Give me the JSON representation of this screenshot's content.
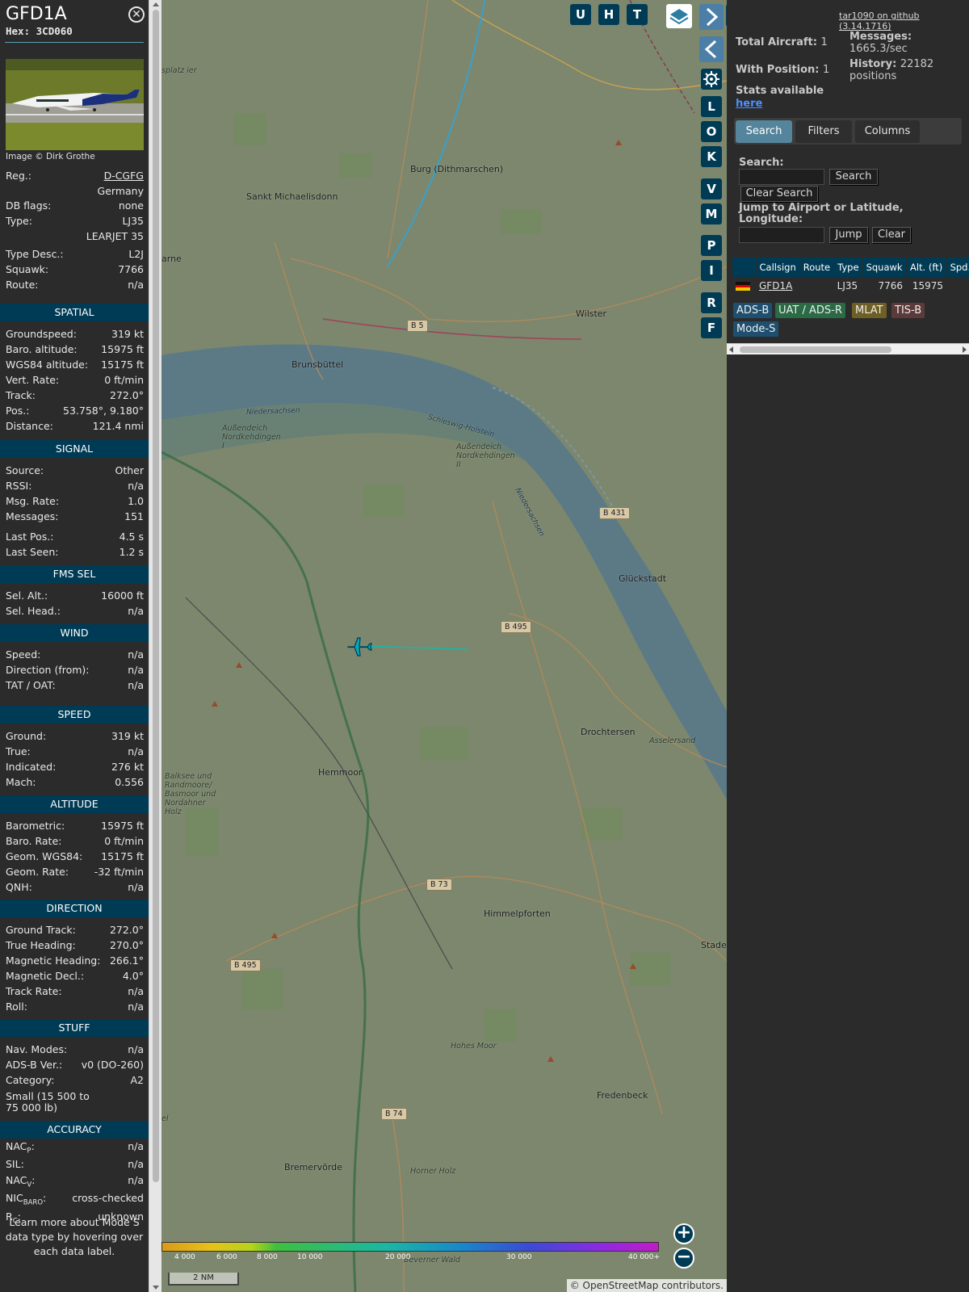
{
  "info": {
    "callsign": "GFD1A",
    "hex_label": "Hex:",
    "hex": "3CD060",
    "photo_credit": "Image © Dirk Grothe",
    "basic": [
      {
        "k": "Reg.:",
        "v": "D-CGFG",
        "link": true
      },
      {
        "k": "",
        "v": "Germany"
      },
      {
        "k": "DB flags:",
        "v": "none"
      },
      {
        "k": "Type:",
        "v": "LJ35"
      },
      {
        "k": "",
        "v": "LEARJET 35"
      },
      {
        "k": "Type Desc.:",
        "v": "L2J"
      },
      {
        "k": "Squawk:",
        "v": "7766"
      },
      {
        "k": "Route:",
        "v": "n/a"
      }
    ],
    "sections": [
      {
        "title": "SPATIAL",
        "rows": [
          {
            "k": "Groundspeed:",
            "v": "319 kt"
          },
          {
            "k": "Baro. altitude:",
            "v": "15975 ft"
          },
          {
            "k": "WGS84 altitude:",
            "v": "15175 ft"
          },
          {
            "k": "Vert. Rate:",
            "v": "0 ft/min"
          },
          {
            "k": "Track:",
            "v": "272.0°"
          },
          {
            "k": "Pos.:",
            "v": "53.758°, 9.180°"
          },
          {
            "k": "Distance:",
            "v": "121.4 nmi"
          }
        ]
      },
      {
        "title": "SIGNAL",
        "rows": [
          {
            "k": "Source:",
            "v": "Other"
          },
          {
            "k": "RSSI:",
            "v": "n/a"
          },
          {
            "k": "Msg. Rate:",
            "v": "1.0"
          },
          {
            "k": "Messages:",
            "v": "151"
          },
          {
            "k": "Last Pos.:",
            "v": "4.5 s"
          },
          {
            "k": "Last Seen:",
            "v": "1.2 s"
          }
        ]
      },
      {
        "title": "FMS SEL",
        "rows": [
          {
            "k": "Sel. Alt.:",
            "v": "16000 ft"
          },
          {
            "k": "Sel. Head.:",
            "v": "n/a"
          }
        ]
      },
      {
        "title": "WIND",
        "rows": [
          {
            "k": "Speed:",
            "v": "n/a"
          },
          {
            "k": "Direction (from):",
            "v": "n/a"
          },
          {
            "k": "TAT / OAT:",
            "v": "n/a"
          }
        ]
      },
      {
        "title": "SPEED",
        "rows": [
          {
            "k": "Ground:",
            "v": "319 kt"
          },
          {
            "k": "True:",
            "v": "n/a"
          },
          {
            "k": "Indicated:",
            "v": "276 kt"
          },
          {
            "k": "Mach:",
            "v": "0.556"
          }
        ]
      },
      {
        "title": "ALTITUDE",
        "rows": [
          {
            "k": "Barometric:",
            "v": "15975 ft"
          },
          {
            "k": "Baro. Rate:",
            "v": "0 ft/min"
          },
          {
            "k": "Geom. WGS84:",
            "v": "15175 ft"
          },
          {
            "k": "Geom. Rate:",
            "v": "-32 ft/min"
          },
          {
            "k": "QNH:",
            "v": "n/a"
          }
        ]
      },
      {
        "title": "DIRECTION",
        "rows": [
          {
            "k": "Ground Track:",
            "v": "272.0°"
          },
          {
            "k": "True Heading:",
            "v": "270.0°"
          },
          {
            "k": "Magnetic Heading:",
            "v": "266.1°"
          },
          {
            "k": "Magnetic Decl.:",
            "v": "4.0°"
          },
          {
            "k": "Track Rate:",
            "v": "n/a"
          },
          {
            "k": "Roll:",
            "v": "n/a"
          }
        ]
      },
      {
        "title": "STUFF",
        "rows": [
          {
            "k": "Nav. Modes:",
            "v": "n/a"
          },
          {
            "k": "ADS-B Ver.:",
            "v": "v0 (DO-260)"
          },
          {
            "k": "Category:",
            "v": "A2"
          },
          {
            "k": "Small (15 500 to 75 000 lb)",
            "v": "",
            "wrap": true
          }
        ]
      }
    ],
    "accuracy_title": "ACCURACY",
    "accuracy": [
      {
        "k": "NAC",
        "sub": "P",
        "suffix": ":",
        "v": "n/a"
      },
      {
        "k": "SIL:",
        "sub": "",
        "suffix": "",
        "v": "n/a"
      },
      {
        "k": "NAC",
        "sub": "V",
        "suffix": ":",
        "v": "n/a"
      },
      {
        "k": "NIC",
        "sub": "BARO",
        "suffix": ":",
        "v": "cross-checked"
      },
      {
        "k": "R",
        "sub": "C",
        "suffix": ":",
        "v": "unknown"
      }
    ],
    "learn_more": "Learn more about Mode S data type by hovering over each data label."
  },
  "map": {
    "toolbar_top": [
      "U",
      "H",
      "T"
    ],
    "toolbar_side": [
      "L",
      "O",
      "K",
      "V",
      "M",
      "P",
      "I",
      "R",
      "F"
    ],
    "places": [
      {
        "name": "Burg (Dithmarschen)",
        "cls": ""
      },
      {
        "name": "Sankt Michaelisdonn",
        "cls": ""
      },
      {
        "name": "Wilster",
        "cls": ""
      },
      {
        "name": "Brunsbüttel",
        "cls": ""
      },
      {
        "name": "Glückstadt",
        "cls": ""
      },
      {
        "name": "Drochtersen",
        "cls": ""
      },
      {
        "name": "Hemmoor",
        "cls": ""
      },
      {
        "name": "Himmelpforten",
        "cls": ""
      },
      {
        "name": "Stade",
        "cls": ""
      },
      {
        "name": "Fredenbeck",
        "cls": ""
      },
      {
        "name": "Bremervörde",
        "cls": ""
      },
      {
        "name": "Niedersachsen",
        "cls": "water"
      },
      {
        "name": "Schleswig-Holstein",
        "cls": "water"
      },
      {
        "name": "Niedersachsen",
        "cls": "water"
      },
      {
        "name": "Außendeich Nordkehdingen I",
        "cls": "small"
      },
      {
        "name": "Außendeich Nordkehdingen II",
        "cls": "small"
      },
      {
        "name": "Asselersand",
        "cls": "small"
      },
      {
        "name": "Balksee und Randmoore/ Basmoor und Nordahner Holz",
        "cls": "small"
      },
      {
        "name": "Hohes Moor",
        "cls": "small"
      },
      {
        "name": "Horner Holz",
        "cls": "small"
      },
      {
        "name": "Beverner Wald",
        "cls": "small"
      },
      {
        "name": "arne",
        "cls": ""
      },
      {
        "name": "splatz ier",
        "cls": "small"
      },
      {
        "name": "el",
        "cls": "small"
      }
    ],
    "roads": [
      "B 5",
      "B 431",
      "B 495",
      "B 73",
      "B 495",
      "B 74"
    ],
    "altitude_ticks": [
      "4 000",
      "6 000",
      "8 000",
      "10 000",
      "20 000",
      "30 000",
      "40 000+"
    ],
    "scale": "2 NM",
    "attribution": "© OpenStreetMap contributors."
  },
  "sidebar": {
    "github": "tar1090 on github (3.14.1716)",
    "total_label": "Total Aircraft:",
    "total": "1",
    "position_label": "With Position:",
    "position": "1",
    "stats_label": "Stats available",
    "stats_link": "here",
    "messages_label": "Messages:",
    "messages": "1665.3/sec",
    "history_label": "History:",
    "history": "22182 positions",
    "tabs": [
      "Search",
      "Filters",
      "Columns"
    ],
    "search_label": "Search:",
    "search_btn": "Search",
    "clear_search_btn": "Clear Search",
    "jump_label": "Jump to Airport or Latitude, Longitude:",
    "jump_btn": "Jump",
    "clear_btn": "Clear",
    "columns": [
      "Callsign",
      "Route",
      "Type",
      "Squawk",
      "Alt. (ft)",
      "Spd."
    ],
    "rows": [
      {
        "callsign": "GFD1A",
        "route": "",
        "type": "LJ35",
        "squawk": "7766",
        "alt": "15975",
        "spd": ""
      }
    ],
    "legend": [
      {
        "label": "ADS-B",
        "color": "#1e4f6e"
      },
      {
        "label": "UAT / ADS-R",
        "color": "#2a6a45"
      },
      {
        "label": "MLAT",
        "color": "#6f5f25"
      },
      {
        "label": "TIS-B",
        "color": "#5c3a3a"
      },
      {
        "label": "Mode-S",
        "color": "#1e4f6e"
      }
    ]
  }
}
